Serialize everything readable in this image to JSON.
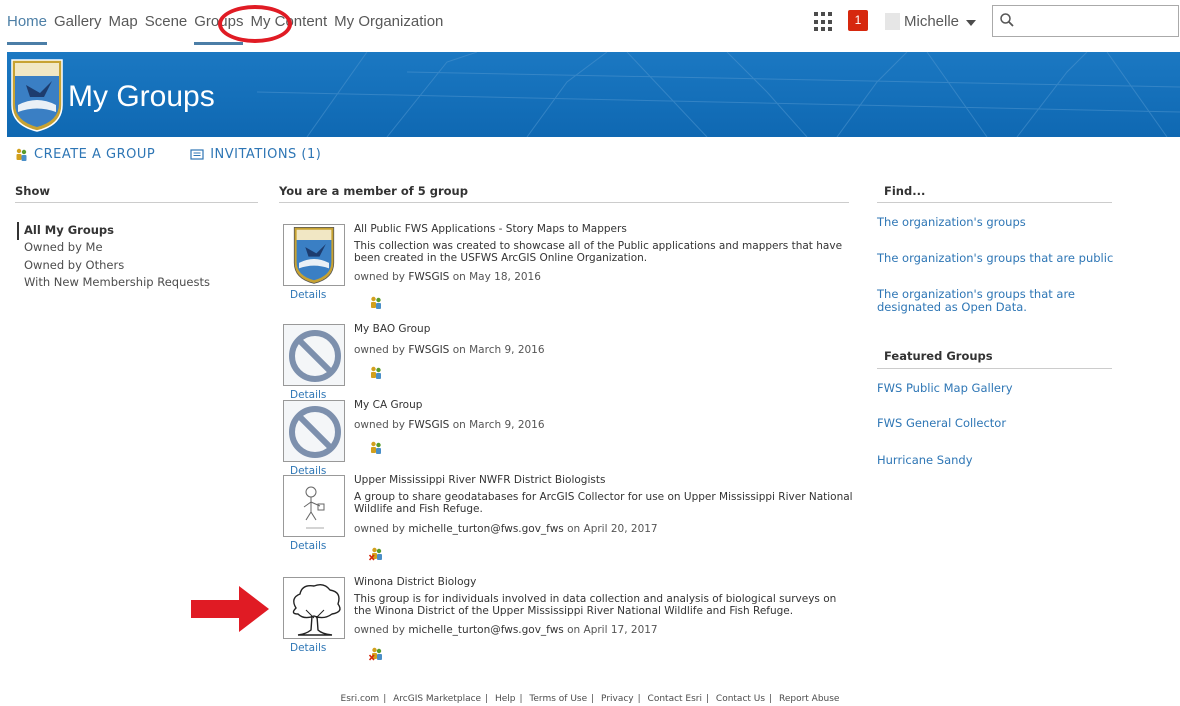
{
  "nav": {
    "items": [
      "Home",
      "Gallery",
      "Map",
      "Scene",
      "Groups",
      "My Content",
      "My Organization"
    ],
    "notifications": "1",
    "user": "Michelle",
    "search_placeholder": ""
  },
  "banner": {
    "title": "My Groups"
  },
  "actions": {
    "create": "CREATE A GROUP",
    "invitations": "INVITATIONS (1)"
  },
  "show": {
    "header": "Show",
    "items": [
      "All My Groups",
      "Owned by Me",
      "Owned by Others",
      "With New Membership Requests"
    ]
  },
  "groups_header": "You are a member of 5 group",
  "groups": [
    {
      "title": "All Public FWS Applications - Story Maps to Mappers",
      "description": "This collection was created to showcase all of the Public applications and mappers that have been created in the USFWS ArcGIS Online Organization.",
      "owner_prefix": "owned by ",
      "owner": "FWSGIS",
      "date_text": " on May 18, 2016",
      "details": "Details"
    },
    {
      "title": "My BAO Group",
      "description": "",
      "owner_prefix": "owned by ",
      "owner": "FWSGIS",
      "date_text": " on March 9, 2016",
      "details": "Details"
    },
    {
      "title": "My CA Group",
      "description": "",
      "owner_prefix": "owned by ",
      "owner": "FWSGIS",
      "date_text": " on March 9, 2016",
      "details": "Details"
    },
    {
      "title": "Upper Mississippi River NWFR District Biologists",
      "description": "A group to share geodatabases for ArcGIS Collector for use on Upper Mississippi River National Wildlife and Fish Refuge.",
      "owner_prefix": "owned by ",
      "owner": "michelle_turton@fws.gov_fws",
      "date_text": " on April 20, 2017",
      "details": "Details"
    },
    {
      "title": "Winona District Biology",
      "description": "This group is for individuals involved in data collection and analysis of biological surveys on the Winona District of the Upper Mississippi River National Wildlife and Fish Refuge.",
      "owner_prefix": "owned by ",
      "owner": "michelle_turton@fws.gov_fws",
      "date_text": " on April 17, 2017",
      "details": "Details"
    }
  ],
  "find": {
    "header": "Find...",
    "links": [
      "The organization's groups",
      "The organization's groups that are public",
      "The organization's groups that are designated as Open Data."
    ],
    "featured_header": "Featured Groups",
    "featured": [
      "FWS Public Map Gallery",
      "FWS General Collector",
      "Hurricane Sandy"
    ]
  },
  "footer": [
    "Esri.com",
    "ArcGIS Marketplace",
    "Help",
    "Terms of Use",
    "Privacy",
    "Contact Esri",
    "Contact Us",
    "Report Abuse"
  ],
  "colors": {
    "link": "#2e76b5",
    "banner": "#1b78c2",
    "badge": "#d6280e",
    "annotation": "#e01b24"
  }
}
